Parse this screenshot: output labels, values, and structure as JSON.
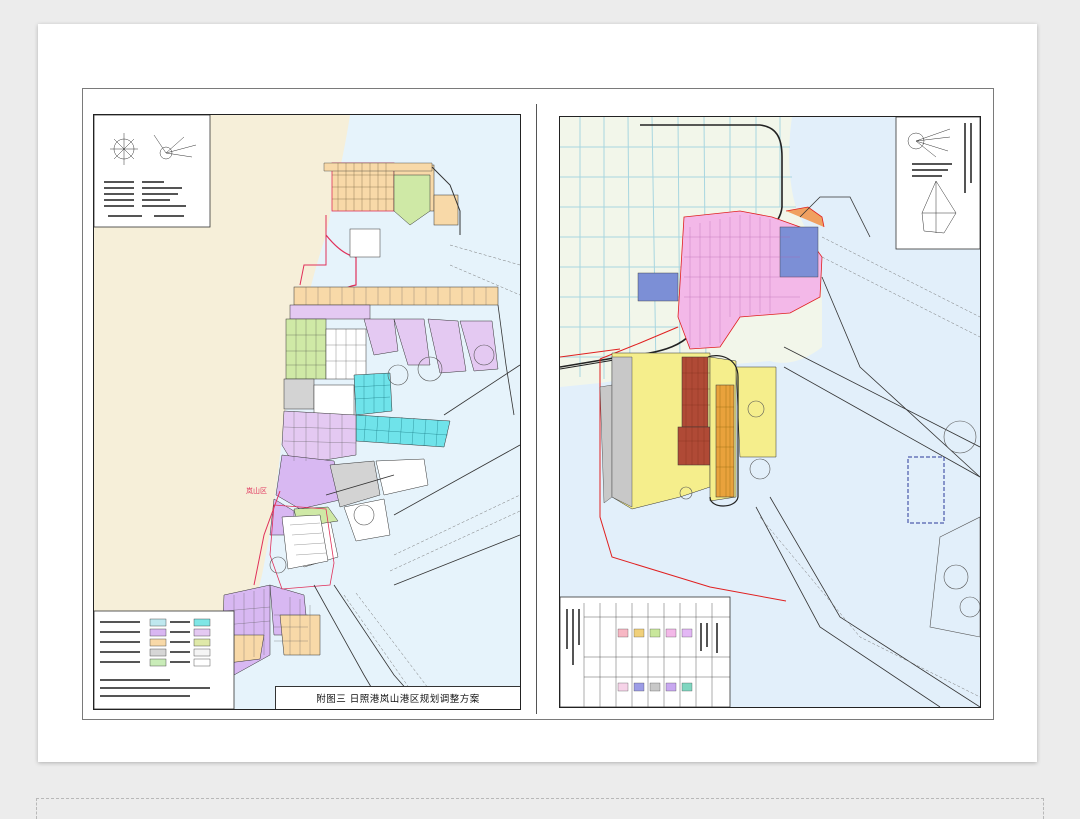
{
  "left_map": {
    "title": "附图三 日照港岚山港区规划调整方案",
    "place_label": "岚山区",
    "legend_colors": [
      "#bfe8ef",
      "#7fe6e6",
      "#d9b6f2",
      "#e4c9f2",
      "#f8d9a8",
      "#dfe9a8",
      "#d6d6d6",
      "#f5f5f5",
      "#c9ecb8",
      "#ffffff"
    ],
    "colors": {
      "sea": "#e6f3fb",
      "land": "#f6efd9",
      "cyan": "#6fe3ea",
      "violet": "#d8b8f2",
      "orange": "#f6c98c",
      "green": "#cfe9a6",
      "grey": "#d3d3d3",
      "route": "#e0305a"
    }
  },
  "right_map": {
    "colors": {
      "sea": "#e2effa",
      "land": "#f2f6ea",
      "road": "#a8d6e0",
      "pink": "#f3b8e8",
      "blue": "#7c8fd6",
      "yellow": "#f5ee8c",
      "brown": "#b04a36",
      "amber": "#e9a23c",
      "grey": "#c8c8c8",
      "rail": "#222222",
      "red": "#e02020"
    },
    "legend_colors": [
      "#f7b7c4",
      "#f0d07a",
      "#c9e79c",
      "#f3b8e8",
      "#e3b7f5",
      "#f6d3e8",
      "#9c9ce6",
      "#c8c8c8",
      "#c8a8f0",
      "#7fd6c0"
    ]
  }
}
